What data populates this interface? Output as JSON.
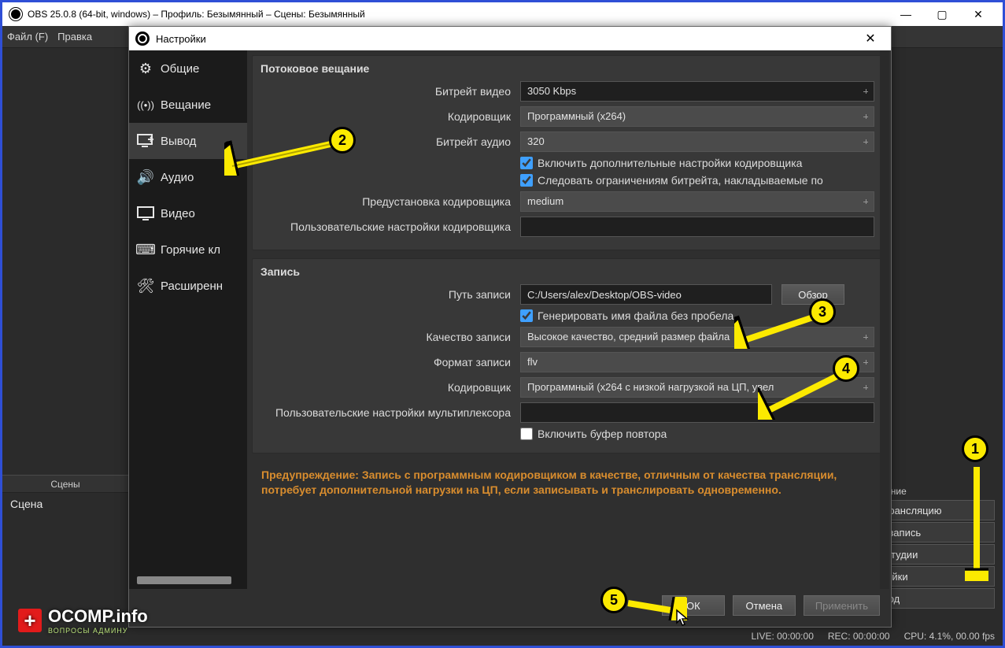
{
  "obs_window": {
    "title": "OBS 25.0.8 (64-bit, windows) – Профиль: Безымянный – Сцены: Безымянный",
    "menu": {
      "file": "Файл (F)",
      "edit": "Правка"
    },
    "scenes_panel_title": "Сцены",
    "scene_name": "Сцена",
    "right_controls": {
      "header": "вление",
      "start_stream": "ь трансляцию",
      "start_record": "ть запись",
      "studio_mode": "м студии",
      "settings": "тройки",
      "exit": "ыход"
    },
    "status": {
      "live": "LIVE: 00:00:00",
      "rec": "REC: 00:00:00",
      "cpu": "CPU: 4.1%, 00.00 fps"
    }
  },
  "dialog": {
    "title": "Настройки",
    "sidebar": {
      "items": [
        {
          "key": "general",
          "label": "Общие",
          "icon": "gear-icon"
        },
        {
          "key": "stream",
          "label": "Вещание",
          "icon": "antenna-icon"
        },
        {
          "key": "output",
          "label": "Вывод",
          "icon": "monitor-out-icon"
        },
        {
          "key": "audio",
          "label": "Аудио",
          "icon": "speaker-icon"
        },
        {
          "key": "video",
          "label": "Видео",
          "icon": "monitor-icon"
        },
        {
          "key": "hotkeys",
          "label": "Горячие кл",
          "icon": "keyboard-icon"
        },
        {
          "key": "advanced",
          "label": "Расширенн",
          "icon": "tools-icon"
        }
      ],
      "active": "output"
    },
    "streaming": {
      "title": "Потоковое вещание",
      "labels": {
        "video_bitrate": "Битрейт видео",
        "encoder": "Кодировщик",
        "audio_bitrate": "Битрейт аудио",
        "chk_extra": "Включить дополнительные настройки кодировщика",
        "chk_limits": "Следовать ограничениям битрейта, накладываемые по",
        "preset": "Предустановка кодировщика",
        "custom": "Пользовательские настройки кодировщика"
      },
      "values": {
        "video_bitrate": "3050 Kbps",
        "encoder": "Программный (x264)",
        "audio_bitrate": "320",
        "preset": "medium",
        "custom": ""
      }
    },
    "recording": {
      "title": "Запись",
      "labels": {
        "path": "Путь записи",
        "browse": "Обзор",
        "no_space": "Генерировать имя файла без пробела",
        "quality": "Качество записи",
        "format": "Формат записи",
        "encoder": "Кодировщик",
        "muxer": "Пользовательские настройки мультиплексора",
        "replay": "Включить буфер повтора"
      },
      "values": {
        "path": "C:/Users/alex/Desktop/OBS-video",
        "quality": "Высокое качество, средний размер файла",
        "format": "flv",
        "encoder": "Программный (х264 с низкой нагрузкой на ЦП, увел",
        "muxer": ""
      }
    },
    "warning": "Предупреждение: Запись с программным кодировщиком в качестве, отличным от качества трансляции, потребует дополнительной нагрузки на ЦП, если записывать и транслировать одновременно.",
    "buttons": {
      "ok": "ОК",
      "cancel": "Отмена",
      "apply": "Применить"
    }
  },
  "annotations": {
    "badges": [
      "1",
      "2",
      "3",
      "4",
      "5"
    ]
  },
  "watermark": {
    "text": "OCOMP.info",
    "sub": "ВОПРОСЫ АДМИНУ"
  },
  "colors": {
    "accent": "#3fa0ff",
    "warn": "#d98d2e",
    "badge": "#fcea00"
  }
}
